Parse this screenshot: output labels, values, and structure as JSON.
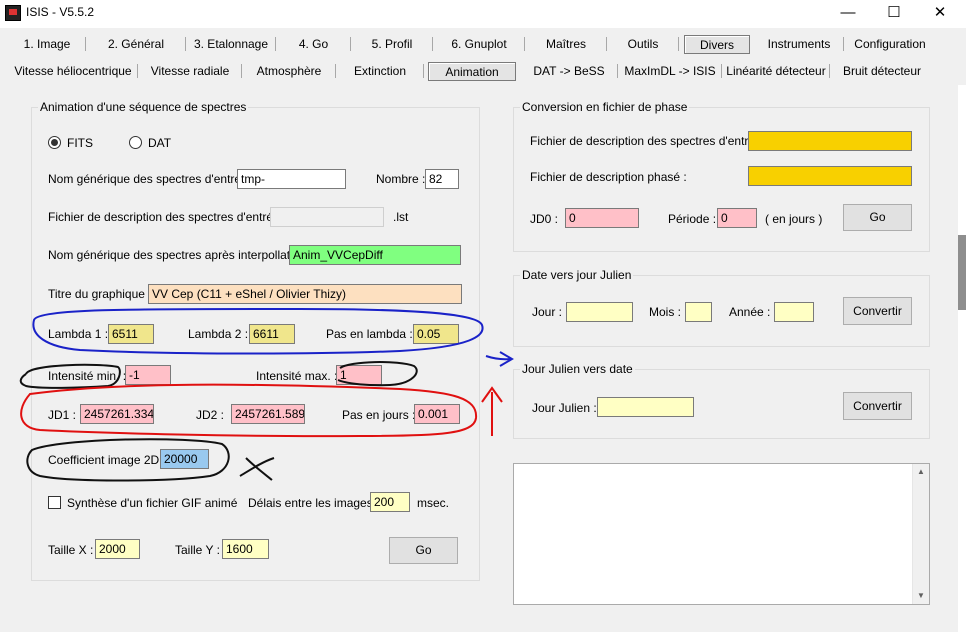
{
  "window": {
    "title": "ISIS - V5.5.2",
    "min": "—",
    "max": "☐",
    "close": "✕"
  },
  "tabs_row1": [
    "1. Image",
    "2. Général",
    "3. Etalonnage",
    "4. Go",
    "5. Profil",
    "6. Gnuplot",
    "Maîtres",
    "Outils",
    "Divers",
    "Instruments",
    "Configuration"
  ],
  "tabs_row2": [
    "Vitesse héliocentrique",
    "Vitesse radiale",
    "Atmosphère",
    "Extinction",
    "Animation",
    "DAT -> BeSS",
    "MaxImDL -> ISIS",
    "Linéarité détecteur",
    "Bruit détecteur"
  ],
  "active_tab1": "Divers",
  "active_tab2": "Animation",
  "animation": {
    "title": "Animation d'une séquence de spectres",
    "fits_label": "FITS",
    "dat_label": "DAT",
    "selected_format": "FITS",
    "input_name_label": "Nom générique des spectres d'entrée :",
    "input_name": "tmp-",
    "count_label": "Nombre :",
    "count": "82",
    "desc_file_label": "Fichier de description des spectres d'entrée :",
    "desc_file": "",
    "lst_label": ".lst",
    "interp_label": "Nom générique des spectres après interpollation :",
    "interp_name": "Anim_VVCepDiff",
    "graph_title_label": "Titre du graphique :",
    "graph_title": "VV Cep (C11 + eShel / Olivier Thizy)",
    "lambda1_label": "Lambda 1 :",
    "lambda1": "6511",
    "lambda2_label": "Lambda 2 :",
    "lambda2": "6611",
    "step_lambda_label": "Pas en lambda :",
    "step_lambda": "0.05",
    "int_min_label": "Intensité min. :",
    "int_min": "-1",
    "int_max_label": "Intensité max. :",
    "int_max": "1",
    "jd1_label": "JD1 :",
    "jd1": "2457261.334",
    "jd2_label": "JD2 :",
    "jd2": "2457261.589",
    "step_days_label": "Pas en jours :",
    "step_days": "0.001",
    "coef_label": "Coefficient image 2D :",
    "coef": "20000",
    "gif_label": "Synthèse d'un fichier GIF animé",
    "delay_label": "Délais entre les images :",
    "delay": "200",
    "msec_label": "msec.",
    "size_x_label": "Taille X :",
    "size_x": "2000",
    "size_y_label": "Taille Y :",
    "size_y": "1600",
    "go_label": "Go"
  },
  "phase": {
    "title": "Conversion en fichier de phase",
    "input_desc_label": "Fichier de description des spectres d'entrée :",
    "input_desc": "",
    "phased_desc_label": "Fichier de description phasé :",
    "phased_desc": "",
    "jd0_label": "JD0 :",
    "jd0": "0",
    "period_label": "Période :",
    "period": "0",
    "days_label": "( en jours )",
    "go_label": "Go"
  },
  "to_julian": {
    "title": "Date vers jour Julien",
    "day_label": "Jour :",
    "day": "",
    "month_label": "Mois :",
    "month": "",
    "year_label": "Année :",
    "year": "",
    "convert_label": "Convertir"
  },
  "from_julian": {
    "title": "Jour Julien vers date",
    "jd_label": "Jour Julien :",
    "jd": "",
    "convert_label": "Convertir"
  },
  "log": {
    "text": ""
  },
  "colors": {
    "yellow": "#ffffc4",
    "gold": "#f8d000",
    "pink": "#ffc0c8",
    "green": "#80ff80",
    "peach": "#fde0c0",
    "khaki": "#f0e68c",
    "blue_select": "#99c9ef"
  }
}
